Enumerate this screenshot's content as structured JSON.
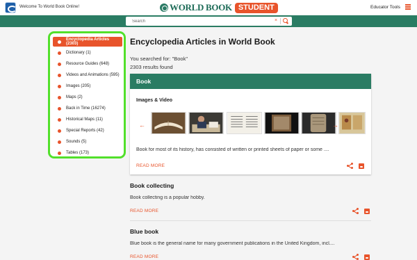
{
  "header": {
    "welcome": "Welcome To World Book Online!",
    "brand_name": "WORLD BOOK",
    "brand_badge": "STUDENT",
    "educator_tools": "Educator Tools"
  },
  "search": {
    "placeholder": "Search",
    "clear_glyph": "×"
  },
  "facets": [
    {
      "label": "Encyclopedia Articles (2303)",
      "active": true
    },
    {
      "label": "Dictionary (1)"
    },
    {
      "label": "Resource Guides (648)"
    },
    {
      "label": "Videos and Animations (595)"
    },
    {
      "label": "Images (205)"
    },
    {
      "label": "Maps (2)"
    },
    {
      "label": "Back in Time (16274)"
    },
    {
      "label": "Historical Maps (11)"
    },
    {
      "label": "Special Reports (42)"
    },
    {
      "label": "Sounds (5)"
    },
    {
      "label": "Tables (173)"
    }
  ],
  "main": {
    "title": "Encyclopedia Articles in World Book",
    "searched_for": "You searched for: \"Book\"",
    "results_found": "2303 results found"
  },
  "featured": {
    "title": "Book",
    "media_heading": "Images & Video",
    "prev_glyph": "←",
    "next_glyph": "→",
    "thumbnails": [
      "open book",
      "person reading",
      "printed page",
      "dark manuscript",
      "stone tablet",
      "illuminated manuscript"
    ],
    "description": "Book for most of its history, has consisted of written or printed sheets of paper or some ....",
    "read_more": "READ MORE"
  },
  "results": [
    {
      "title": "Book collecting",
      "snippet": "Book collecting is a popular hobby.",
      "read_more": "READ MORE"
    },
    {
      "title": "Blue book",
      "snippet": "Blue book is the general name for many government publications in the United Kingdom, incl....",
      "read_more": "READ MORE"
    }
  ],
  "colors": {
    "accent": "#e8542b",
    "brand_green": "#2a7c63",
    "highlight_outline": "#52e02b"
  },
  "icons": [
    "site-logo-icon",
    "world-book-logo-icon",
    "menu-icon",
    "search-icon",
    "share-icon",
    "save-icon",
    "arrow-left-icon",
    "arrow-right-icon"
  ]
}
